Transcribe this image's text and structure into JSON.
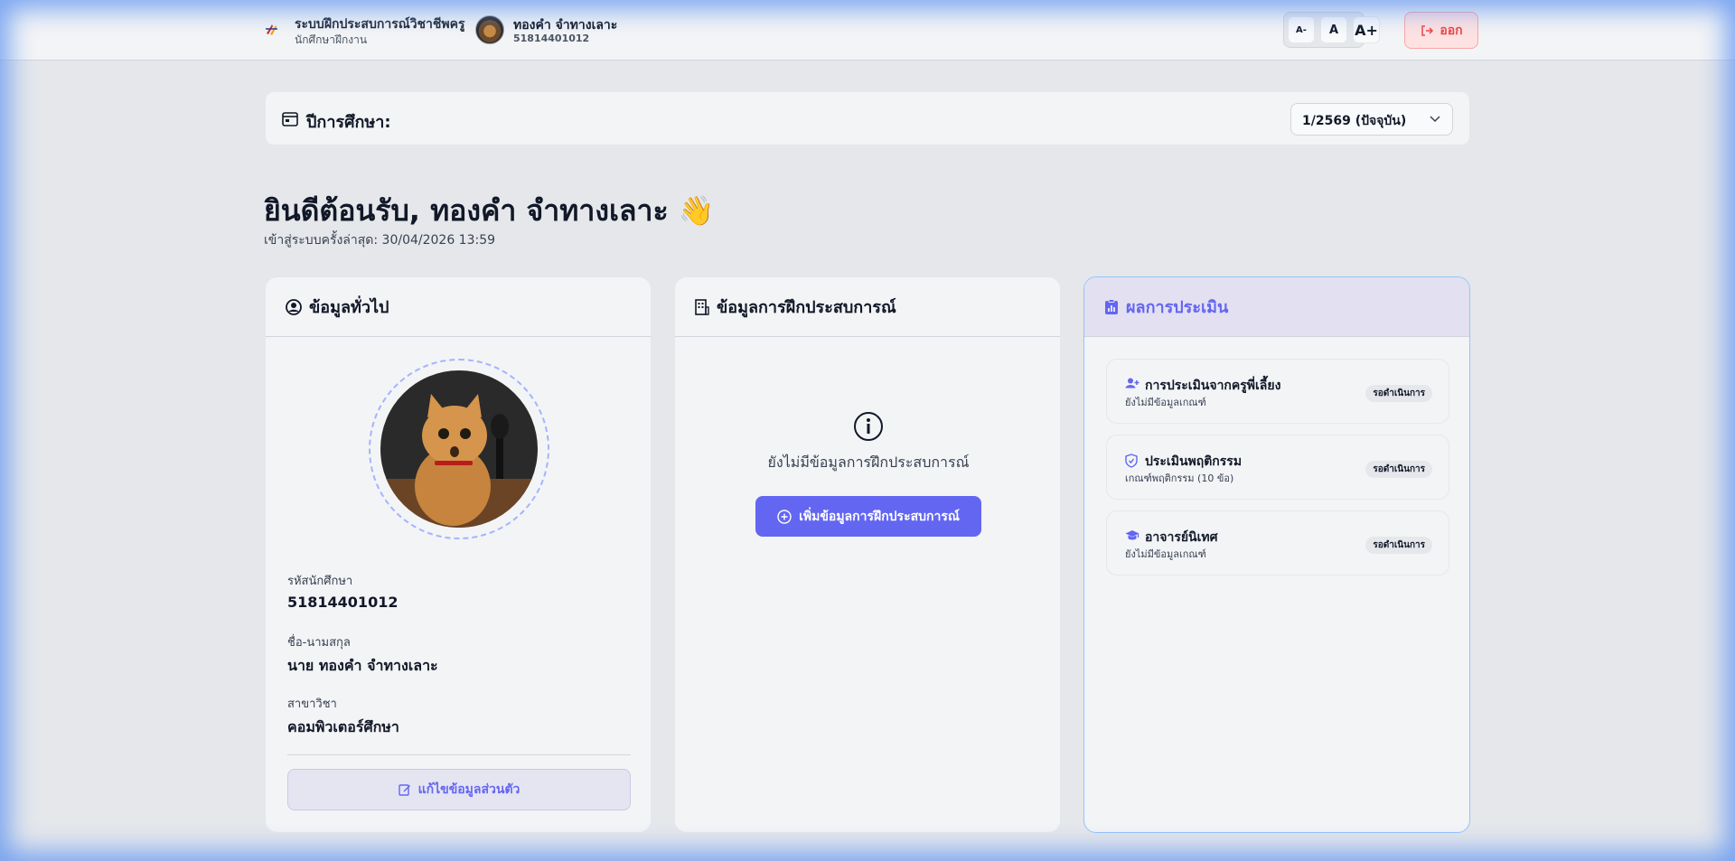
{
  "header": {
    "brand_title": "ระบบฝึกประสบการณ์วิชาชีพครู",
    "brand_subtitle": "นักศึกษาฝึกงาน",
    "user_name": "ทองคำ จำทางเลาะ",
    "user_id": "51814401012",
    "font_small": "A-",
    "font_normal": "A",
    "font_large": "A+",
    "logout_label": "ออก"
  },
  "year_selector": {
    "label": "ปีการศึกษา:",
    "selected": "1/2569 (ปัจจุบัน)"
  },
  "welcome": {
    "title": "ยินดีต้อนรับ, ทองคำ จำทางเลาะ 👋",
    "last_login": "เข้าสู่ระบบครั้งล่าสุด: 30/04/2026 13:59"
  },
  "general_info": {
    "title": "ข้อมูลทั่วไป",
    "student_id_label": "รหัสนักศึกษา",
    "student_id": "51814401012",
    "name_label": "ชื่อ-นามสกุล",
    "name": "นาย ทองคำ จำทางเลาะ",
    "major_label": "สาขาวิชา",
    "major": "คอมพิวเตอร์ศึกษา",
    "edit_label": "แก้ไขข้อมูลส่วนตัว"
  },
  "internship": {
    "title": "ข้อมูลการฝึกประสบการณ์",
    "empty_text": "ยังไม่มีข้อมูลการฝึกประสบการณ์",
    "add_label": "เพิ่มข้อมูลการฝึกประสบการณ์"
  },
  "evaluation": {
    "title": "ผลการประเมิน",
    "items": [
      {
        "icon": "user-group-icon",
        "title": "การประเมินจากครูพี่เลี้ยง",
        "subtitle": "ยังไม่มีข้อมูลเกณฑ์",
        "status": "รอดำเนินการ"
      },
      {
        "icon": "shield-check-icon",
        "title": "ประเมินพฤติกรรม",
        "subtitle": "เกณฑ์พฤติกรรม (10 ข้อ)",
        "status": "รอดำเนินการ"
      },
      {
        "icon": "graduation-cap-icon",
        "title": "อาจารย์นิเทศ",
        "subtitle": "ยังไม่มีข้อมูลเกณฑ์",
        "status": "รอดำเนินการ"
      }
    ]
  },
  "colors": {
    "accent": "#6366f1",
    "logout": "#ef4444",
    "background": "#e5e7eb"
  }
}
